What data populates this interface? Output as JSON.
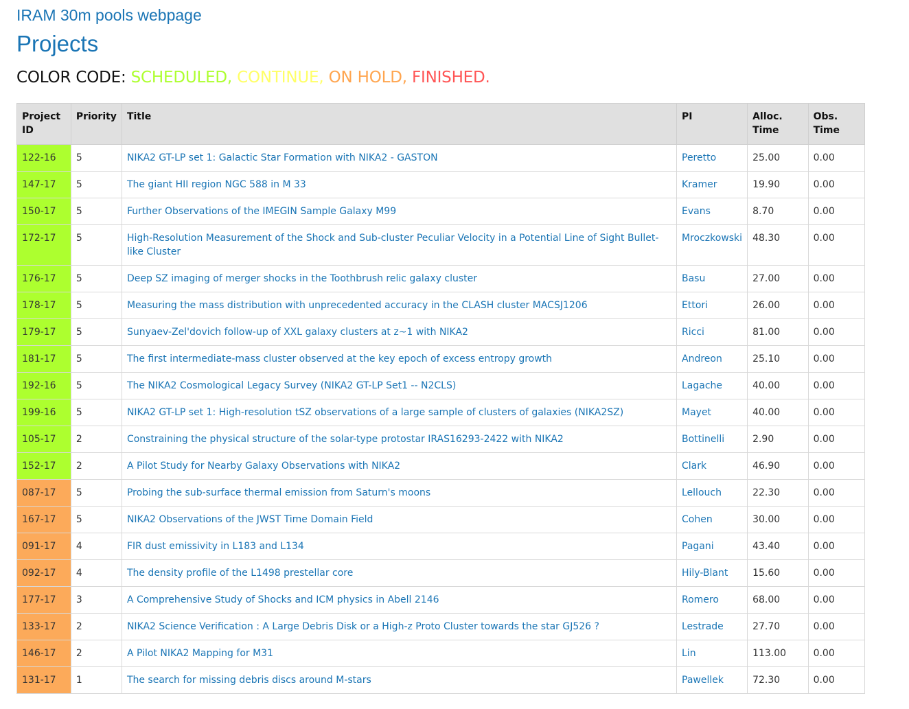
{
  "header": {
    "site_link": "IRAM 30m pools webpage",
    "page_title": "Projects"
  },
  "color_code": {
    "label": "COLOR CODE:",
    "items": [
      {
        "text": "SCHEDULED,",
        "color": "#adff2f"
      },
      {
        "text": "CONTINUE,",
        "color": "#ffff66"
      },
      {
        "text": "ON HOLD,",
        "color": "#ffa54f"
      },
      {
        "text": "FINISHED.",
        "color": "#ff5555"
      }
    ]
  },
  "status_colors": {
    "scheduled": "#adff2f",
    "on_hold": "#fcaa5a"
  },
  "table": {
    "columns": [
      "Project ID",
      "Priority",
      "Title",
      "PI",
      "Alloc. Time",
      "Obs. Time"
    ],
    "rows": [
      {
        "id": "122-16",
        "priority": "5",
        "title": "NIKA2 GT-LP set 1: Galactic Star Formation with NIKA2 - GASTON",
        "pi": "Peretto",
        "alloc": "25.00",
        "obs": "0.00",
        "status": "scheduled"
      },
      {
        "id": "147-17",
        "priority": "5",
        "title": "The giant HII region NGC 588 in M 33",
        "pi": "Kramer",
        "alloc": "19.90",
        "obs": "0.00",
        "status": "scheduled"
      },
      {
        "id": "150-17",
        "priority": "5",
        "title": "Further Observations of the IMEGIN Sample Galaxy M99",
        "pi": "Evans",
        "alloc": "8.70",
        "obs": "0.00",
        "status": "scheduled"
      },
      {
        "id": "172-17",
        "priority": "5",
        "title": "High-Resolution Measurement of the Shock and Sub-cluster Peculiar Velocity in a Potential Line of Sight Bullet-like Cluster",
        "pi": "Mroczkowski",
        "alloc": "48.30",
        "obs": "0.00",
        "status": "scheduled"
      },
      {
        "id": "176-17",
        "priority": "5",
        "title": "Deep SZ imaging of merger shocks in the Toothbrush relic galaxy cluster",
        "pi": "Basu",
        "alloc": "27.00",
        "obs": "0.00",
        "status": "scheduled"
      },
      {
        "id": "178-17",
        "priority": "5",
        "title": "Measuring the mass distribution with unprecedented accuracy in the CLASH cluster MACSJ1206",
        "pi": "Ettori",
        "alloc": "26.00",
        "obs": "0.00",
        "status": "scheduled"
      },
      {
        "id": "179-17",
        "priority": "5",
        "title": "Sunyaev-Zel'dovich follow-up of XXL galaxy clusters at z~1 with NIKA2",
        "pi": "Ricci",
        "alloc": "81.00",
        "obs": "0.00",
        "status": "scheduled"
      },
      {
        "id": "181-17",
        "priority": "5",
        "title": "The first intermediate-mass cluster observed at the key epoch of excess entropy growth",
        "pi": "Andreon",
        "alloc": "25.10",
        "obs": "0.00",
        "status": "scheduled"
      },
      {
        "id": "192-16",
        "priority": "5",
        "title": "The NIKA2 Cosmological Legacy Survey (NIKA2 GT-LP Set1 -- N2CLS)",
        "pi": "Lagache",
        "alloc": "40.00",
        "obs": "0.00",
        "status": "scheduled"
      },
      {
        "id": "199-16",
        "priority": "5",
        "title": "NIKA2 GT-LP set 1: High-resolution tSZ observations of a large sample of clusters of galaxies (NIKA2SZ)",
        "pi": "Mayet",
        "alloc": "40.00",
        "obs": "0.00",
        "status": "scheduled"
      },
      {
        "id": "105-17",
        "priority": "2",
        "title": "Constraining the physical structure of the solar-type protostar IRAS16293-2422 with NIKA2",
        "pi": "Bottinelli",
        "alloc": "2.90",
        "obs": "0.00",
        "status": "scheduled"
      },
      {
        "id": "152-17",
        "priority": "2",
        "title": "A Pilot Study for Nearby Galaxy Observations with NIKA2",
        "pi": "Clark",
        "alloc": "46.90",
        "obs": "0.00",
        "status": "scheduled"
      },
      {
        "id": "087-17",
        "priority": "5",
        "title": "Probing the sub-surface thermal emission from Saturn's moons",
        "pi": "Lellouch",
        "alloc": "22.30",
        "obs": "0.00",
        "status": "on_hold"
      },
      {
        "id": "167-17",
        "priority": "5",
        "title": "NIKA2 Observations of the JWST Time Domain Field",
        "pi": "Cohen",
        "alloc": "30.00",
        "obs": "0.00",
        "status": "on_hold"
      },
      {
        "id": "091-17",
        "priority": "4",
        "title": "FIR dust emissivity in L183 and L134",
        "pi": "Pagani",
        "alloc": "43.40",
        "obs": "0.00",
        "status": "on_hold"
      },
      {
        "id": "092-17",
        "priority": "4",
        "title": "The density profile of the L1498 prestellar core",
        "pi": "Hily-Blant",
        "alloc": "15.60",
        "obs": "0.00",
        "status": "on_hold"
      },
      {
        "id": "177-17",
        "priority": "3",
        "title": "A Comprehensive Study of Shocks and ICM physics in Abell 2146",
        "pi": "Romero",
        "alloc": "68.00",
        "obs": "0.00",
        "status": "on_hold"
      },
      {
        "id": "133-17",
        "priority": "2",
        "title": "NIKA2 Science Verification : A Large Debris Disk or a High-z Proto Cluster towards the star GJ526 ?",
        "pi": "Lestrade",
        "alloc": "27.70",
        "obs": "0.00",
        "status": "on_hold"
      },
      {
        "id": "146-17",
        "priority": "2",
        "title": "A Pilot NIKA2 Mapping for M31",
        "pi": "Lin",
        "alloc": "113.00",
        "obs": "0.00",
        "status": "on_hold"
      },
      {
        "id": "131-17",
        "priority": "1",
        "title": "The search for missing debris discs around M-stars",
        "pi": "Pawellek",
        "alloc": "72.30",
        "obs": "0.00",
        "status": "on_hold"
      }
    ]
  }
}
